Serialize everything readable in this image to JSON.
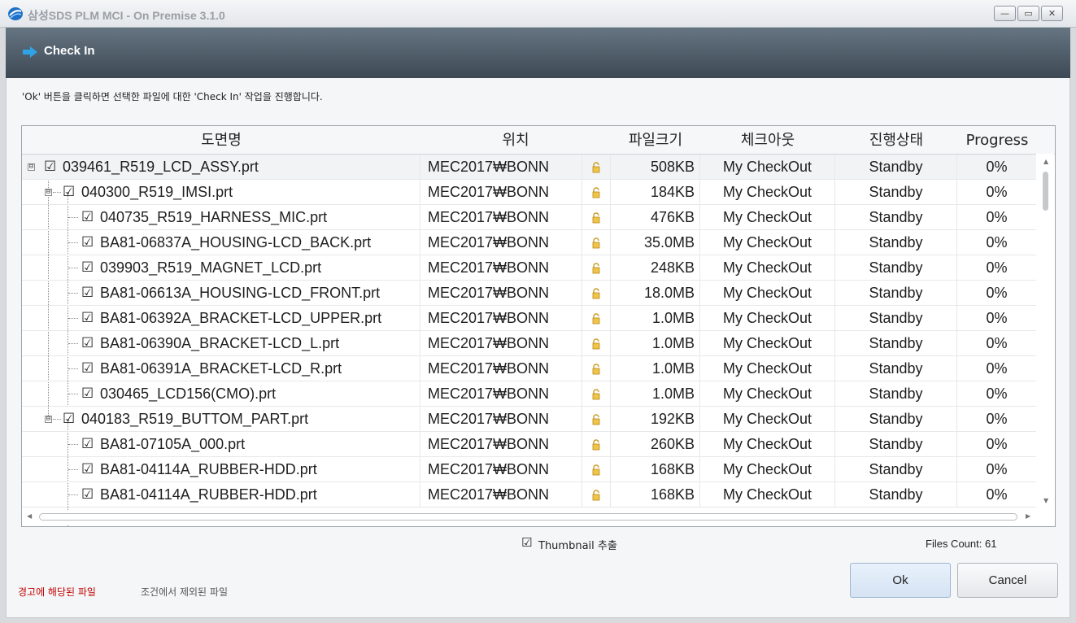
{
  "window": {
    "title": "삼성SDS PLM MCI - On Premise 3.1.0",
    "min": "—",
    "max": "▭",
    "close": "✕"
  },
  "header": {
    "title": "Check In"
  },
  "instruction": "'Ok' 버튼을 클릭하면 선택한 파일에 대한 'Check In' 작업을 진행합니다.",
  "columns": {
    "name": "도면명",
    "location": "위치",
    "size": "파일크기",
    "checkout": "체크아웃",
    "status": "진행상태",
    "progress": "Progress"
  },
  "rows": [
    {
      "name": "039461_R519_LCD_ASSY.prt",
      "location": "MEC2017₩BONN",
      "size": "508KB",
      "checkout": "My CheckOut",
      "status": "Standby",
      "progress": "0%"
    },
    {
      "name": "040300_R519_IMSI.prt",
      "location": "MEC2017₩BONN",
      "size": "184KB",
      "checkout": "My CheckOut",
      "status": "Standby",
      "progress": "0%"
    },
    {
      "name": "040735_R519_HARNESS_MIC.prt",
      "location": "MEC2017₩BONN",
      "size": "476KB",
      "checkout": "My CheckOut",
      "status": "Standby",
      "progress": "0%"
    },
    {
      "name": "BA81-06837A_HOUSING-LCD_BACK.prt",
      "location": "MEC2017₩BONN",
      "size": "35.0MB",
      "checkout": "My CheckOut",
      "status": "Standby",
      "progress": "0%"
    },
    {
      "name": "039903_R519_MAGNET_LCD.prt",
      "location": "MEC2017₩BONN",
      "size": "248KB",
      "checkout": "My CheckOut",
      "status": "Standby",
      "progress": "0%"
    },
    {
      "name": "BA81-06613A_HOUSING-LCD_FRONT.prt",
      "location": "MEC2017₩BONN",
      "size": "18.0MB",
      "checkout": "My CheckOut",
      "status": "Standby",
      "progress": "0%"
    },
    {
      "name": "BA81-06392A_BRACKET-LCD_UPPER.prt",
      "location": "MEC2017₩BONN",
      "size": "1.0MB",
      "checkout": "My CheckOut",
      "status": "Standby",
      "progress": "0%"
    },
    {
      "name": "BA81-06390A_BRACKET-LCD_L.prt",
      "location": "MEC2017₩BONN",
      "size": "1.0MB",
      "checkout": "My CheckOut",
      "status": "Standby",
      "progress": "0%"
    },
    {
      "name": "BA81-06391A_BRACKET-LCD_R.prt",
      "location": "MEC2017₩BONN",
      "size": "1.0MB",
      "checkout": "My CheckOut",
      "status": "Standby",
      "progress": "0%"
    },
    {
      "name": "030465_LCD156(CMO).prt",
      "location": "MEC2017₩BONN",
      "size": "1.0MB",
      "checkout": "My CheckOut",
      "status": "Standby",
      "progress": "0%"
    },
    {
      "name": "040183_R519_BUTTOM_PART.prt",
      "location": "MEC2017₩BONN",
      "size": "192KB",
      "checkout": "My CheckOut",
      "status": "Standby",
      "progress": "0%"
    },
    {
      "name": "BA81-07105A_000.prt",
      "location": "MEC2017₩BONN",
      "size": "260KB",
      "checkout": "My CheckOut",
      "status": "Standby",
      "progress": "0%"
    },
    {
      "name": "BA81-04114A_RUBBER-HDD.prt",
      "location": "MEC2017₩BONN",
      "size": "168KB",
      "checkout": "My CheckOut",
      "status": "Standby",
      "progress": "0%"
    },
    {
      "name": "BA81-04114A_RUBBER-HDD.prt",
      "location": "MEC2017₩BONN",
      "size": "168KB",
      "checkout": "My CheckOut",
      "status": "Standby",
      "progress": "0%"
    }
  ],
  "footer": {
    "thumbnail_label": "Thumbnail 추출",
    "files_count": "Files Count: 61",
    "ok_label": "Ok",
    "cancel_label": "Cancel",
    "legend_warning": "경고에 해당된 파일",
    "legend_excluded": "조건에서 제외된 파일"
  },
  "icons": {
    "check": "☑",
    "expander": "⊟",
    "lock": "lock-icon",
    "arrow": "arrow-right-icon"
  },
  "colors": {
    "header_bg": "#4a5663",
    "warning_text": "#c00000",
    "arrow": "#2fa3e8"
  }
}
